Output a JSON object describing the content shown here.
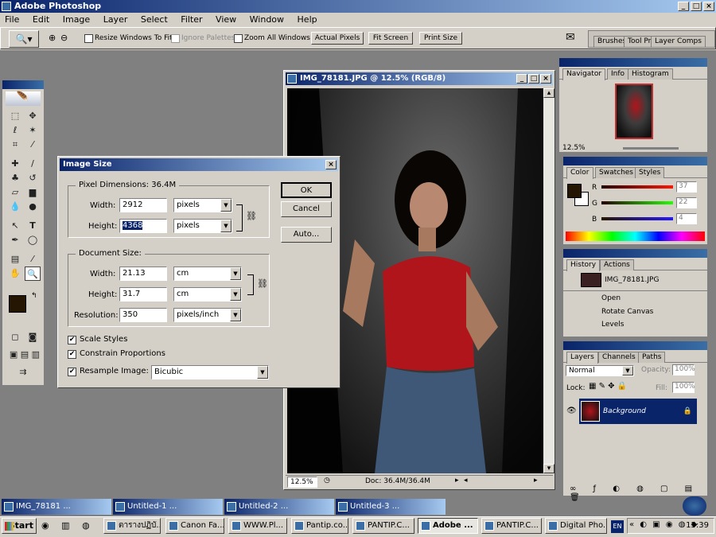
{
  "app": {
    "title": "Adobe Photoshop"
  },
  "menu": [
    "File",
    "Edit",
    "Image",
    "Layer",
    "Select",
    "Filter",
    "View",
    "Window",
    "Help"
  ],
  "options": {
    "resize_windows": "Resize Windows To Fit",
    "ignore_palettes": "Ignore Palettes",
    "zoom_all": "Zoom All Windows",
    "actual_pixels": "Actual Pixels",
    "fit_screen": "Fit Screen",
    "print_size": "Print Size",
    "well_tabs": [
      "Brushes",
      "Tool Pr",
      "Layer Comps"
    ]
  },
  "doc": {
    "title": "IMG_78181.JPG @ 12.5% (RGB/8)",
    "zoom": "12.5%",
    "status": "Doc: 36.4M/36.4M"
  },
  "dialog": {
    "title": "Image Size",
    "pixel_dims_label": "Pixel Dimensions:",
    "pixel_dims_value": "36.4M",
    "width_label": "Width:",
    "height_label": "Height:",
    "px_width": "2912",
    "px_height": "4368",
    "px_unit": "pixels",
    "doc_size_label": "Document Size:",
    "doc_width": "21.13",
    "doc_height": "31.7",
    "doc_unit": "cm",
    "resolution_label": "Resolution:",
    "resolution": "350",
    "res_unit": "pixels/inch",
    "scale_styles": "Scale Styles",
    "constrain": "Constrain Proportions",
    "resample": "Resample Image:",
    "resample_method": "Bicubic",
    "ok": "OK",
    "cancel": "Cancel",
    "auto": "Auto..."
  },
  "navigator": {
    "tabs": [
      "Navigator",
      "Info",
      "Histogram"
    ],
    "zoom": "12.5%"
  },
  "color": {
    "tabs": [
      "Color",
      "Swatches",
      "Styles"
    ],
    "r_label": "R",
    "g_label": "G",
    "b_label": "B",
    "r": "37",
    "g": "22",
    "b": "4",
    "fg_color": "#251604"
  },
  "history": {
    "tabs": [
      "History",
      "Actions"
    ],
    "snapshot": "IMG_78181.JPG",
    "items": [
      "Open",
      "Rotate Canvas",
      "Levels"
    ]
  },
  "layers": {
    "tabs": [
      "Layers",
      "Channels",
      "Paths"
    ],
    "blend": "Normal",
    "opacity_label": "Opacity:",
    "opacity": "100%",
    "lock_label": "Lock:",
    "fill_label": "Fill:",
    "fill": "100%",
    "layer_name": "Background"
  },
  "minimized": [
    "IMG_78181 ...",
    "Untitled-1 ...",
    "Untitled-2 ...",
    "Untitled-3 ..."
  ],
  "taskbar": {
    "start": "Start",
    "items": [
      "ตารางปฏิบั...",
      "Canon Fa...",
      "WWW.Pl...",
      "Pantip.co...",
      "PANTIP.C...",
      "Adobe ...",
      "PANTIP.C...",
      "Digital Pho..."
    ],
    "lang": "EN",
    "time": "15:39"
  }
}
